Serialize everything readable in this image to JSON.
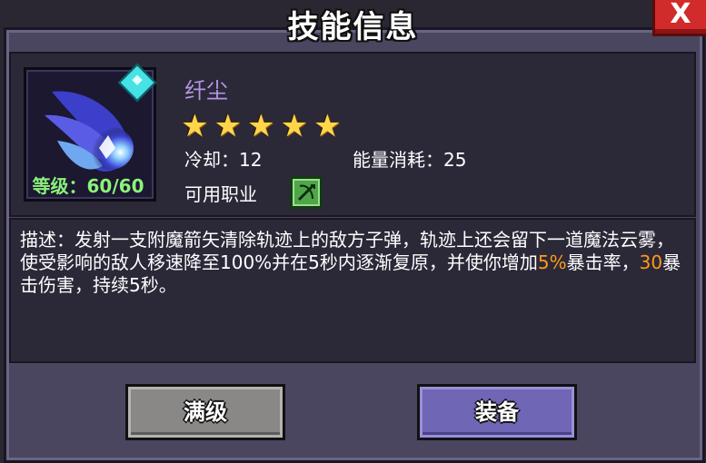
{
  "dialog": {
    "title": "技能信息",
    "close_label": "X"
  },
  "skill": {
    "name": "纤尘",
    "stars": 5,
    "level_text": "等级：60/60",
    "cooldown": "冷却：12",
    "energy_cost": "能量消耗：25",
    "class_label": "可用职业",
    "icon": "blue-flame-swirl-icon"
  },
  "description": {
    "part1": "描述：发射一支附魔箭矢清除轨迹上的敌方子弹，轨迹上还会留下一道魔法云雾，使受影响的敌人移速降至100%并在5秒内逐渐复原，并使你增加",
    "hl1": "5%",
    "part2": "暴击率，",
    "hl2": "30",
    "part3": "暴击伤害，持续5秒。"
  },
  "buttons": {
    "max_level": "满级",
    "equip": "装备"
  },
  "colors": {
    "panel": "#4a4660",
    "skill_name": "#b594e6",
    "highlight": "#ff9a1a",
    "level": "#8bf27a",
    "equip_button": "#6f66b5"
  }
}
